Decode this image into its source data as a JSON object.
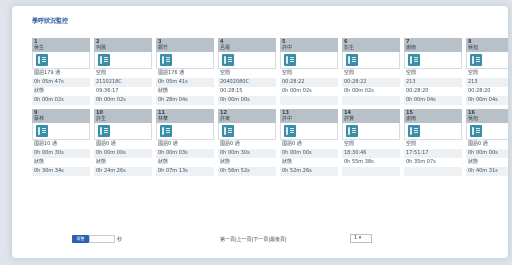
{
  "title": "學呼狀況監控",
  "rows": [
    [
      {
        "num": "1",
        "name": "吳生",
        "status": "國語179 通",
        "time1": "0h 05m 47s",
        "label": "狀態",
        "time2": "0h 00m 02s"
      },
      {
        "num": "2",
        "name": "何晨",
        "status": "空閒",
        "time1": "2110218C",
        "label": "09:36:17",
        "time2": "0h 00m 02s"
      },
      {
        "num": "3",
        "name": "鄭竹",
        "status": "國語176 通",
        "time1": "0h 05m 41s",
        "label": "狀態",
        "time2": "0h 28m 04s"
      },
      {
        "num": "4",
        "name": "呂電",
        "status": "空閒",
        "time1": "20402080C",
        "label": "00:28:15",
        "time2": "0h 00m 00s"
      },
      {
        "num": "5",
        "name": "許中",
        "status": "空閒",
        "time1": "00:28:22",
        "label": "0h 00m 02s",
        "time2": ""
      },
      {
        "num": "6",
        "name": "彭生",
        "status": "空閒",
        "time1": "00:28:22",
        "label": "0h 00m 02s",
        "time2": ""
      },
      {
        "num": "7",
        "name": "謝南",
        "status": "空閒",
        "time1": "213",
        "label": "00:28:20",
        "time2": "0h 00m 04s"
      },
      {
        "num": "8",
        "name": "吳旭",
        "status": "空閒",
        "time1": "213",
        "label": "00:28:20",
        "time2": "0h 00m 04s"
      }
    ],
    [
      {
        "num": "9",
        "name": "蔡林",
        "status": "國語10 通",
        "time1": "0h 00m 30s",
        "label": "狀態",
        "time2": "0h 30m 34s"
      },
      {
        "num": "10",
        "name": "許生",
        "status": "國語0 通",
        "time1": "0h 00m 00s",
        "label": "狀態",
        "time2": "0h 24m 26s"
      },
      {
        "num": "11",
        "name": "林華",
        "status": "國語0 通",
        "time1": "0h 00m 03s",
        "label": "狀態",
        "time2": "0h 07m 13s"
      },
      {
        "num": "12",
        "name": "許東",
        "status": "國語0 通",
        "time1": "0h 00m 30s",
        "label": "狀態",
        "time2": "0h 56m 52s"
      },
      {
        "num": "13",
        "name": "許中",
        "status": "國語0 通",
        "time1": "0h 00m 00s",
        "label": "狀態",
        "time2": "0h 52m 26s"
      },
      {
        "num": "14",
        "name": "許賢",
        "status": "空閒",
        "time1": "18:30:46",
        "label": "0h 55m 38s",
        "time2": ""
      },
      {
        "num": "15",
        "name": "謝南",
        "status": "空閒",
        "time1": "17:51:17",
        "label": "0h 35m 07s",
        "time2": ""
      },
      {
        "num": "16",
        "name": "吳旭",
        "status": "國語0 通",
        "time1": "0h 00m 00s",
        "label": "狀態",
        "time2": "0h 40m 31s"
      }
    ]
  ],
  "footer": {
    "button": "再整",
    "unit": "秒",
    "pager": "第一頁|上一頁|下一頁|最後頁|",
    "page": "1"
  }
}
